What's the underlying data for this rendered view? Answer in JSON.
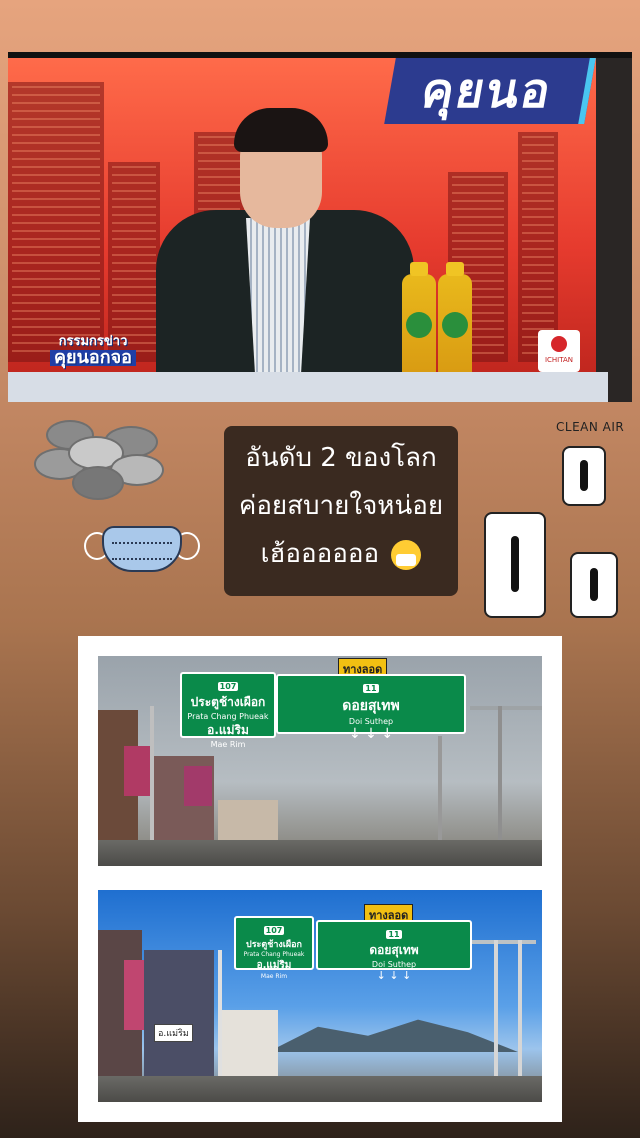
{
  "tv": {
    "show_logo": "คุยนอ",
    "program_name_line1": "กรรมกรข่าว",
    "program_name_line2": "คุยนอกจอ",
    "sponsor": "ICHITAN"
  },
  "caption": {
    "line1": "อันดับ 2 ของโลก",
    "line2": "ค่อยสบายใจหน่อย",
    "line3": "เฮ้ออออออ"
  },
  "sticker": {
    "clean_air_label": "CLEAN AIR"
  },
  "road_photos": {
    "bypass_label": "ทางลอด",
    "sign_left": {
      "route": "107",
      "title_th": "ประตูช้างเผือก",
      "title_en": "Prata Chang Phueak",
      "dest_th": "อ.แม่ริม",
      "dest_en": "Mae Rim",
      "arrow": "↖"
    },
    "sign_right": {
      "route": "11",
      "title_th": "ดอยสุเทพ",
      "title_en": "Doi Suthep",
      "arrows": "↓    ↓    ↓"
    },
    "roadside_sign": "อ.แม่ริม"
  }
}
